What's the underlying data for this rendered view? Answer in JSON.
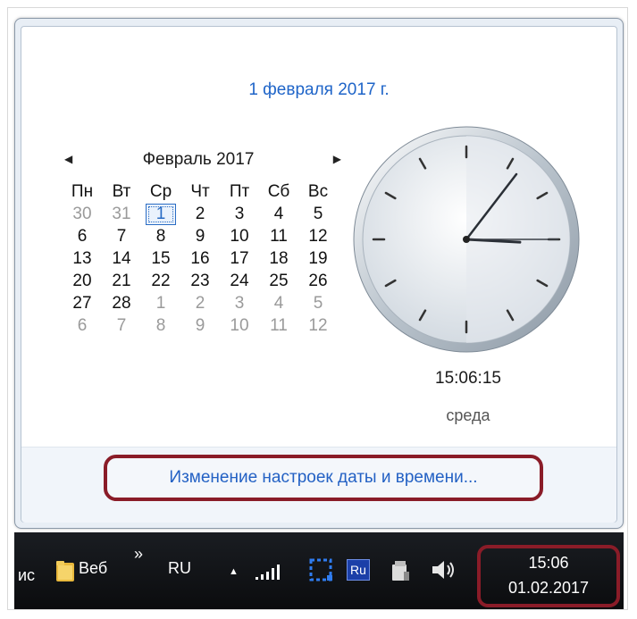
{
  "flyout": {
    "long_date": "1 февраля 2017 г.",
    "settings_link": "Изменение настроек даты и времени..."
  },
  "calendar": {
    "month_title": "Февраль 2017",
    "prev_icon": "triangle-left-icon",
    "next_icon": "triangle-right-icon",
    "weekdays": [
      "Пн",
      "Вт",
      "Ср",
      "Чт",
      "Пт",
      "Сб",
      "Вс"
    ],
    "weeks": [
      [
        {
          "d": "30",
          "m": true
        },
        {
          "d": "31",
          "m": true
        },
        {
          "d": "1",
          "t": true
        },
        {
          "d": "2"
        },
        {
          "d": "3"
        },
        {
          "d": "4"
        },
        {
          "d": "5"
        }
      ],
      [
        {
          "d": "6"
        },
        {
          "d": "7"
        },
        {
          "d": "8"
        },
        {
          "d": "9"
        },
        {
          "d": "10"
        },
        {
          "d": "11"
        },
        {
          "d": "12"
        }
      ],
      [
        {
          "d": "13"
        },
        {
          "d": "14"
        },
        {
          "d": "15"
        },
        {
          "d": "16"
        },
        {
          "d": "17"
        },
        {
          "d": "18"
        },
        {
          "d": "19"
        }
      ],
      [
        {
          "d": "20"
        },
        {
          "d": "21"
        },
        {
          "d": "22"
        },
        {
          "d": "23"
        },
        {
          "d": "24"
        },
        {
          "d": "25"
        },
        {
          "d": "26"
        }
      ],
      [
        {
          "d": "27"
        },
        {
          "d": "28"
        },
        {
          "d": "1",
          "m": true
        },
        {
          "d": "2",
          "m": true
        },
        {
          "d": "3",
          "m": true
        },
        {
          "d": "4",
          "m": true
        },
        {
          "d": "5",
          "m": true
        }
      ],
      [
        {
          "d": "6",
          "m": true
        },
        {
          "d": "7",
          "m": true
        },
        {
          "d": "8",
          "m": true
        },
        {
          "d": "9",
          "m": true
        },
        {
          "d": "10",
          "m": true
        },
        {
          "d": "11",
          "m": true
        },
        {
          "d": "12",
          "m": true
        }
      ]
    ]
  },
  "clock": {
    "time": "15:06:15",
    "weekday": "среда",
    "hour": 15,
    "minute": 6,
    "second": 15
  },
  "taskbar": {
    "partial_item": "ис",
    "folder_label": "Веб",
    "overflow_chevron": "»",
    "language": "RU",
    "up_arrow": "▲",
    "ime_badge": "Ru",
    "tray_time": "15:06",
    "tray_date": "01.02.2017"
  },
  "colors": {
    "accent_link": "#2361c4",
    "highlight_ring": "#8a1c28",
    "taskbar_bg": "#0b0c0e"
  }
}
